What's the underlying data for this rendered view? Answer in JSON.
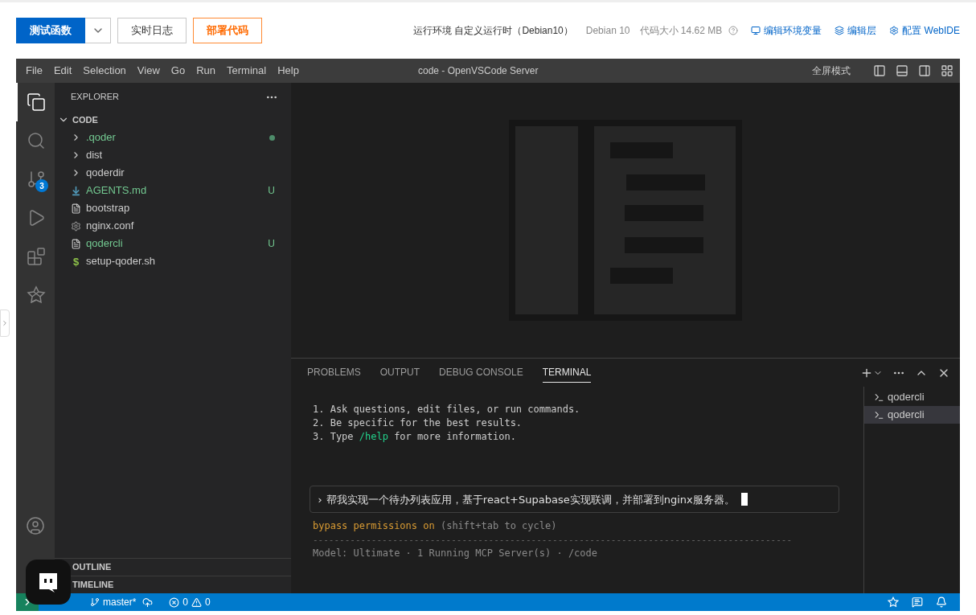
{
  "top_bar": {
    "buttons": [
      {
        "label": "测试函数",
        "kind": "primary"
      },
      {
        "label": "实时日志",
        "kind": "default"
      },
      {
        "label": "部署代码",
        "kind": "warning"
      }
    ],
    "runtime": "运行环境 自定义运行时（Debian10）",
    "os": "Debian 10",
    "code_size": "代码大小 14.62 MB",
    "links": [
      {
        "label": "编辑环境变量",
        "kind": "env"
      },
      {
        "label": "编辑层",
        "kind": "layers"
      },
      {
        "label": "配置 WebIDE",
        "kind": "config"
      }
    ]
  },
  "ide": {
    "menu": [
      "File",
      "Edit",
      "Selection",
      "View",
      "Go",
      "Run",
      "Terminal",
      "Help"
    ],
    "title": "code - OpenVSCode Server",
    "fullscreen": "全屏模式",
    "activity": [
      {
        "kind": "explorer",
        "selected": true
      },
      {
        "kind": "search",
        "selected": false
      },
      {
        "kind": "source-control",
        "selected": false,
        "badge": "3"
      },
      {
        "kind": "run-debug",
        "selected": false
      },
      {
        "kind": "extensions",
        "selected": false
      },
      {
        "kind": "agent",
        "selected": false
      }
    ],
    "explorer": {
      "title": "EXPLORER",
      "root": {
        "name": "CODE",
        "expanded": true
      },
      "items": [
        {
          "name": ".qoder",
          "kind": "folder",
          "expanded": false,
          "highlighted": true,
          "dot": true
        },
        {
          "name": "dist",
          "kind": "folder",
          "expanded": false,
          "highlighted": false,
          "dot": false
        },
        {
          "name": "qoderdir",
          "kind": "folder",
          "expanded": false,
          "highlighted": false,
          "dot": false
        },
        {
          "name": "AGENTS.md",
          "kind": "markdown",
          "highlighted": true,
          "dot": false,
          "badge": "U"
        },
        {
          "name": "bootstrap",
          "kind": "text",
          "highlighted": false,
          "dot": false
        },
        {
          "name": "nginx.conf",
          "kind": "config",
          "highlighted": false,
          "dot": false
        },
        {
          "name": "qodercli",
          "kind": "text",
          "highlighted": true,
          "dot": false,
          "badge": "U"
        },
        {
          "name": "setup-qoder.sh",
          "kind": "shell",
          "glyph": "$",
          "highlighted": false,
          "dot": false
        }
      ],
      "sections": [
        {
          "name": "OUTLINE"
        },
        {
          "name": "TIMELINE"
        }
      ]
    },
    "panel": {
      "tabs": [
        {
          "label": "PROBLEMS",
          "selected": false
        },
        {
          "label": "OUTPUT",
          "selected": false
        },
        {
          "label": "DEBUG CONSOLE",
          "selected": false
        },
        {
          "label": "TERMINAL",
          "selected": true
        }
      ],
      "lines": [
        [
          {
            "text": "1. Ask questions, edit files, or run commands.",
            "kind": "plain"
          }
        ],
        [
          {
            "text": "2. Be specific for the best results.",
            "kind": "plain"
          }
        ],
        [
          {
            "text": "3. Type ",
            "kind": "plain"
          },
          {
            "text": "/help",
            "kind": "command"
          },
          {
            "text": " for more information.",
            "kind": "plain"
          }
        ]
      ],
      "prompt_marker": "›",
      "prompt": "帮我实现一个待办列表应用，基于react+Supabase实现联调，并部署到nginx服务器。",
      "mode": [
        {
          "text": "bypass permissions on",
          "kind": "warning"
        },
        {
          "text": " (shift+tab to cycle)",
          "kind": "muted"
        }
      ],
      "rule": "------------------------------------------------------------------------------------------",
      "footer": "Model: Ultimate · 1 Running MCP Server(s) · /code",
      "terminals": [
        {
          "name": "qodercli",
          "selected": false
        },
        {
          "name": "qodercli",
          "selected": true
        }
      ]
    },
    "status_bar": {
      "branch": "master*",
      "errors": "0",
      "warnings": "0"
    }
  }
}
